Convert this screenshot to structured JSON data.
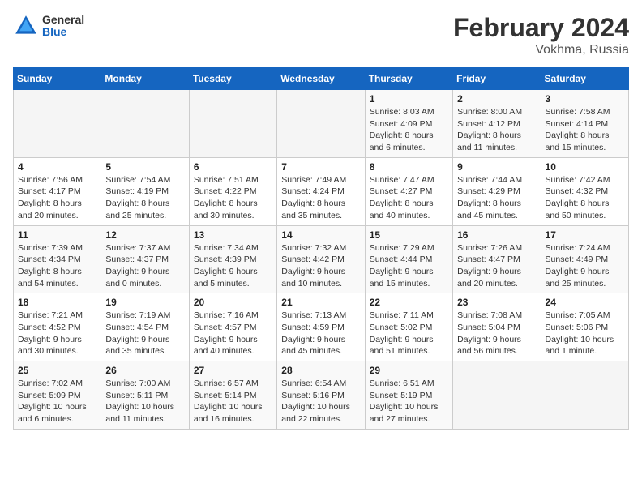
{
  "header": {
    "logo_general": "General",
    "logo_blue": "Blue",
    "title": "February 2024",
    "subtitle": "Vokhma, Russia"
  },
  "calendar": {
    "headers": [
      "Sunday",
      "Monday",
      "Tuesday",
      "Wednesday",
      "Thursday",
      "Friday",
      "Saturday"
    ],
    "weeks": [
      [
        {
          "day": "",
          "detail": ""
        },
        {
          "day": "",
          "detail": ""
        },
        {
          "day": "",
          "detail": ""
        },
        {
          "day": "",
          "detail": ""
        },
        {
          "day": "1",
          "detail": "Sunrise: 8:03 AM\nSunset: 4:09 PM\nDaylight: 8 hours\nand 6 minutes."
        },
        {
          "day": "2",
          "detail": "Sunrise: 8:00 AM\nSunset: 4:12 PM\nDaylight: 8 hours\nand 11 minutes."
        },
        {
          "day": "3",
          "detail": "Sunrise: 7:58 AM\nSunset: 4:14 PM\nDaylight: 8 hours\nand 15 minutes."
        }
      ],
      [
        {
          "day": "4",
          "detail": "Sunrise: 7:56 AM\nSunset: 4:17 PM\nDaylight: 8 hours\nand 20 minutes."
        },
        {
          "day": "5",
          "detail": "Sunrise: 7:54 AM\nSunset: 4:19 PM\nDaylight: 8 hours\nand 25 minutes."
        },
        {
          "day": "6",
          "detail": "Sunrise: 7:51 AM\nSunset: 4:22 PM\nDaylight: 8 hours\nand 30 minutes."
        },
        {
          "day": "7",
          "detail": "Sunrise: 7:49 AM\nSunset: 4:24 PM\nDaylight: 8 hours\nand 35 minutes."
        },
        {
          "day": "8",
          "detail": "Sunrise: 7:47 AM\nSunset: 4:27 PM\nDaylight: 8 hours\nand 40 minutes."
        },
        {
          "day": "9",
          "detail": "Sunrise: 7:44 AM\nSunset: 4:29 PM\nDaylight: 8 hours\nand 45 minutes."
        },
        {
          "day": "10",
          "detail": "Sunrise: 7:42 AM\nSunset: 4:32 PM\nDaylight: 8 hours\nand 50 minutes."
        }
      ],
      [
        {
          "day": "11",
          "detail": "Sunrise: 7:39 AM\nSunset: 4:34 PM\nDaylight: 8 hours\nand 54 minutes."
        },
        {
          "day": "12",
          "detail": "Sunrise: 7:37 AM\nSunset: 4:37 PM\nDaylight: 9 hours\nand 0 minutes."
        },
        {
          "day": "13",
          "detail": "Sunrise: 7:34 AM\nSunset: 4:39 PM\nDaylight: 9 hours\nand 5 minutes."
        },
        {
          "day": "14",
          "detail": "Sunrise: 7:32 AM\nSunset: 4:42 PM\nDaylight: 9 hours\nand 10 minutes."
        },
        {
          "day": "15",
          "detail": "Sunrise: 7:29 AM\nSunset: 4:44 PM\nDaylight: 9 hours\nand 15 minutes."
        },
        {
          "day": "16",
          "detail": "Sunrise: 7:26 AM\nSunset: 4:47 PM\nDaylight: 9 hours\nand 20 minutes."
        },
        {
          "day": "17",
          "detail": "Sunrise: 7:24 AM\nSunset: 4:49 PM\nDaylight: 9 hours\nand 25 minutes."
        }
      ],
      [
        {
          "day": "18",
          "detail": "Sunrise: 7:21 AM\nSunset: 4:52 PM\nDaylight: 9 hours\nand 30 minutes."
        },
        {
          "day": "19",
          "detail": "Sunrise: 7:19 AM\nSunset: 4:54 PM\nDaylight: 9 hours\nand 35 minutes."
        },
        {
          "day": "20",
          "detail": "Sunrise: 7:16 AM\nSunset: 4:57 PM\nDaylight: 9 hours\nand 40 minutes."
        },
        {
          "day": "21",
          "detail": "Sunrise: 7:13 AM\nSunset: 4:59 PM\nDaylight: 9 hours\nand 45 minutes."
        },
        {
          "day": "22",
          "detail": "Sunrise: 7:11 AM\nSunset: 5:02 PM\nDaylight: 9 hours\nand 51 minutes."
        },
        {
          "day": "23",
          "detail": "Sunrise: 7:08 AM\nSunset: 5:04 PM\nDaylight: 9 hours\nand 56 minutes."
        },
        {
          "day": "24",
          "detail": "Sunrise: 7:05 AM\nSunset: 5:06 PM\nDaylight: 10 hours\nand 1 minute."
        }
      ],
      [
        {
          "day": "25",
          "detail": "Sunrise: 7:02 AM\nSunset: 5:09 PM\nDaylight: 10 hours\nand 6 minutes."
        },
        {
          "day": "26",
          "detail": "Sunrise: 7:00 AM\nSunset: 5:11 PM\nDaylight: 10 hours\nand 11 minutes."
        },
        {
          "day": "27",
          "detail": "Sunrise: 6:57 AM\nSunset: 5:14 PM\nDaylight: 10 hours\nand 16 minutes."
        },
        {
          "day": "28",
          "detail": "Sunrise: 6:54 AM\nSunset: 5:16 PM\nDaylight: 10 hours\nand 22 minutes."
        },
        {
          "day": "29",
          "detail": "Sunrise: 6:51 AM\nSunset: 5:19 PM\nDaylight: 10 hours\nand 27 minutes."
        },
        {
          "day": "",
          "detail": ""
        },
        {
          "day": "",
          "detail": ""
        }
      ]
    ]
  }
}
